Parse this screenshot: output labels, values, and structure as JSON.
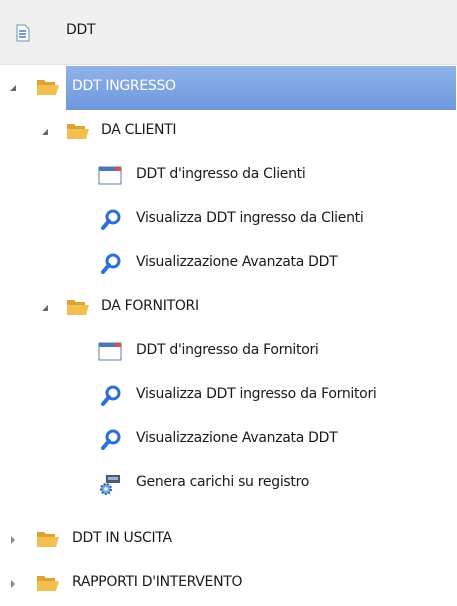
{
  "header": {
    "title": "DDT",
    "icon": "document-icon"
  },
  "tree": {
    "ingresso": {
      "label": "DDT INGRESSO",
      "clienti": {
        "label": "DA CLIENTI",
        "items": [
          "DDT d'ingresso da Clienti",
          "Visualizza DDT ingresso da Clienti",
          "Visualizzazione Avanzata DDT"
        ]
      },
      "fornitori": {
        "label": "DA FORNITORI",
        "items": [
          "DDT d'ingresso da Fornitori",
          "Visualizza DDT ingresso da Fornitori",
          "Visualizzazione Avanzata DDT",
          "Genera carichi su registro"
        ]
      }
    },
    "uscita": {
      "label": "DDT IN USCITA"
    },
    "rapporti": {
      "label": "RAPPORTI D'INTERVENTO"
    }
  },
  "colors": {
    "selection": "#7aa3e4",
    "folder": "#f0b840",
    "search": "#2c6fd6"
  }
}
